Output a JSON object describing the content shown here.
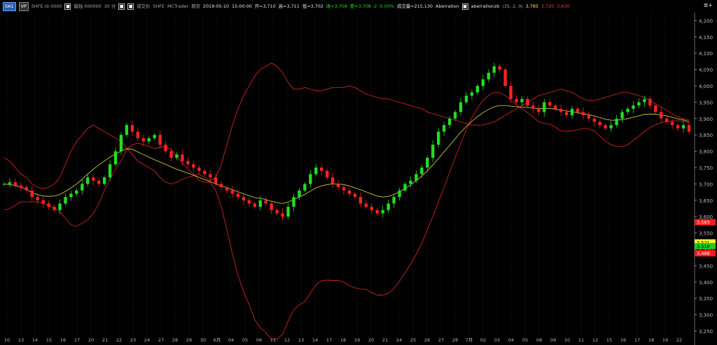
{
  "header": {
    "chart_tag": "SA1",
    "mode_tag": "VP",
    "symbol": "SHFE.rb 0000",
    "symbol_box": "■",
    "chart_type": "蜡烛 000000",
    "interval": "30 分",
    "interval_box": "■",
    "price_type": "成交价",
    "price_box": "■",
    "exchange": "SHFE",
    "provider": "MCTrader",
    "session": "期货",
    "datetime": "2019-05-10",
    "time": "15:00:00",
    "open": "开=3,710",
    "high": "高=3,711",
    "low": "低=3,702",
    "close": "收=3,708",
    "change": "差=3,708 -2 -0.05%",
    "volume": "成交量=215,130",
    "study1_name": "Aberration",
    "study1_box": "■",
    "study2_name": "aberrationzb",
    "study2_params": "(35, 2, 0)",
    "study2_v1": "3,765",
    "study2_v2": "3,720",
    "study2_v3": "3,630",
    "menu_icon": "≣+"
  },
  "colors": {
    "background": "#000000",
    "grid": "#3a3a3a",
    "up": "#22dd22",
    "down": "#ff2222",
    "band": "#cc2222",
    "ma": "#dddd44",
    "signal": "#ffffff",
    "tag_red": "#ff1a1a",
    "tag_green": "#22cc22",
    "tag_yellow": "#ffff22"
  },
  "chart_data": {
    "type": "candlestick",
    "y_ticks": [
      "4,200",
      "4,150",
      "4,100",
      "4,050",
      "4,000",
      "3,950",
      "3,900",
      "3,850",
      "3,800",
      "3,750",
      "3,700",
      "3,650",
      "3,600",
      "3,550",
      "3,500",
      "3,450",
      "3,400",
      "3,350",
      "3,300",
      "3,250"
    ],
    "y_tick_values": [
      4200,
      4150,
      4100,
      4050,
      4000,
      3950,
      3900,
      3850,
      3800,
      3750,
      3700,
      3650,
      3600,
      3550,
      3500,
      3450,
      3400,
      3350,
      3300,
      3250
    ],
    "ylim": [
      3250,
      4220
    ],
    "x_ticks": [
      "10",
      "13",
      "14",
      "15",
      "16",
      "17",
      "20",
      "21",
      "22",
      "23",
      "24",
      "27",
      "28",
      "29",
      "30",
      "6月",
      "04",
      "05",
      "06",
      "11",
      "12",
      "13",
      "14",
      "17",
      "18",
      "19",
      "20",
      "21",
      "24",
      "25",
      "26",
      "27",
      "28",
      "7月",
      "02",
      "03",
      "04",
      "05",
      "08",
      "09",
      "10",
      "11",
      "12",
      "15",
      "16",
      "17",
      "18",
      "19",
      "22"
    ],
    "price_tags": [
      {
        "label": "3,583",
        "value": 3583,
        "color": "tag_red"
      },
      {
        "label": "3,521",
        "value": 3521,
        "color": "tag_yellow"
      },
      {
        "label": "3,510",
        "value": 3510,
        "color": "tag_green"
      },
      {
        "label": "3,488",
        "value": 3488,
        "color": "tag_red"
      }
    ],
    "close_series": [
      3700,
      3705,
      3695,
      3690,
      3680,
      3660,
      3650,
      3640,
      3630,
      3620,
      3640,
      3660,
      3670,
      3680,
      3700,
      3720,
      3710,
      3700,
      3720,
      3760,
      3800,
      3850,
      3880,
      3860,
      3840,
      3830,
      3840,
      3850,
      3820,
      3800,
      3780,
      3790,
      3770,
      3760,
      3750,
      3740,
      3730,
      3720,
      3700,
      3690,
      3680,
      3670,
      3660,
      3650,
      3640,
      3630,
      3650,
      3640,
      3620,
      3610,
      3600,
      3630,
      3660,
      3680,
      3700,
      3730,
      3750,
      3740,
      3720,
      3700,
      3690,
      3680,
      3670,
      3660,
      3640,
      3630,
      3620,
      3610,
      3620,
      3640,
      3660,
      3680,
      3700,
      3710,
      3730,
      3750,
      3780,
      3820,
      3860,
      3880,
      3900,
      3920,
      3950,
      3970,
      3980,
      4000,
      4020,
      4040,
      4060,
      4050,
      4000,
      3960,
      3950,
      3960,
      3940,
      3930,
      3920,
      3950,
      3940,
      3930,
      3920,
      3910,
      3930,
      3920,
      3910,
      3900,
      3890,
      3880,
      3870,
      3880,
      3900,
      3920,
      3930,
      3940,
      3950,
      3960,
      3940,
      3920,
      3900,
      3890,
      3880,
      3870,
      3880,
      3860
    ],
    "upper_band": [
      3780,
      3770,
      3750,
      3730,
      3720,
      3700,
      3690,
      3685,
      3690,
      3700,
      3720,
      3760,
      3800,
      3830,
      3850,
      3870,
      3880,
      3870,
      3860,
      3850,
      3840,
      3830,
      3810,
      3790,
      3770,
      3760,
      3750,
      3740,
      3720,
      3705,
      3700,
      3705,
      3715,
      3720,
      3725,
      3730,
      3720,
      3710,
      3720,
      3760,
      3820,
      3880,
      3930,
      3970,
      4000,
      4030,
      4050,
      4060,
      4070,
      4060,
      4040,
      4010,
      3990,
      3990,
      3995,
      3990,
      3985,
      3985,
      3990,
      3995,
      3995,
      3995,
      4000,
      3995,
      3985,
      3975,
      3970,
      3965,
      3960,
      3960,
      3955,
      3950,
      3945,
      3940,
      3935,
      3930,
      3920,
      3915,
      3910,
      3905,
      3900,
      3895,
      3890,
      3885,
      3880,
      3880,
      3880,
      3885,
      3890,
      3900,
      3910,
      3920,
      3930,
      3940,
      3950,
      3960,
      3970,
      3975,
      3980,
      3985,
      3990,
      3985,
      3980,
      3970,
      3960,
      3955,
      3955,
      3960,
      3965,
      3970,
      3975,
      3980,
      3980,
      3975,
      3970,
      3965,
      3955,
      3945,
      3935,
      3925,
      3915,
      3905,
      3900,
      3895
    ],
    "middle_band": [
      3700,
      3698,
      3695,
      3690,
      3683,
      3673,
      3667,
      3663,
      3662,
      3663,
      3668,
      3677,
      3688,
      3700,
      3715,
      3730,
      3745,
      3758,
      3770,
      3782,
      3792,
      3800,
      3808,
      3806,
      3798,
      3790,
      3782,
      3774,
      3767,
      3760,
      3752,
      3745,
      3739,
      3733,
      3727,
      3720,
      3713,
      3707,
      3700,
      3694,
      3688,
      3682,
      3676,
      3670,
      3664,
      3658,
      3656,
      3652,
      3647,
      3643,
      3640,
      3645,
      3652,
      3660,
      3668,
      3678,
      3688,
      3694,
      3698,
      3700,
      3700,
      3698,
      3694,
      3688,
      3682,
      3676,
      3669,
      3663,
      3660,
      3662,
      3668,
      3676,
      3686,
      3697,
      3710,
      3724,
      3740,
      3758,
      3778,
      3798,
      3818,
      3838,
      3858,
      3876,
      3892,
      3906,
      3918,
      3928,
      3936,
      3940,
      3940,
      3938,
      3936,
      3935,
      3934,
      3932,
      3930,
      3931,
      3931,
      3929,
      3926,
      3923,
      3921,
      3918,
      3915,
      3912,
      3908,
      3903,
      3898,
      3895,
      3895,
      3897,
      3900,
      3904,
      3908,
      3913,
      3914,
      3913,
      3911,
      3908,
      3904,
      3899,
      3896,
      3891
    ],
    "lower_band": [
      3620,
      3625,
      3635,
      3645,
      3645,
      3645,
      3645,
      3640,
      3635,
      3625,
      3615,
      3595,
      3575,
      3570,
      3580,
      3590,
      3610,
      3640,
      3680,
      3715,
      3745,
      3770,
      3805,
      3820,
      3825,
      3820,
      3815,
      3808,
      3812,
      3815,
      3805,
      3785,
      3765,
      3745,
      3730,
      3710,
      3705,
      3705,
      3680,
      3630,
      3560,
      3485,
      3420,
      3370,
      3330,
      3285,
      3260,
      3245,
      3225,
      3225,
      3240,
      3280,
      3315,
      3330,
      3340,
      3366,
      3392,
      3404,
      3406,
      3405,
      3405,
      3400,
      3388,
      3382,
      3378,
      3378,
      3368,
      3360,
      3360,
      3365,
      3380,
      3402,
      3428,
      3455,
      3485,
      3518,
      3560,
      3600,
      3646,
      3690,
      3735,
      3780,
      3825,
      3866,
      3903,
      3932,
      3956,
      3970,
      3980,
      3980,
      3970,
      3957,
      3942,
      3930,
      3918,
      3905,
      3890,
      3885,
      3883,
      3874,
      3862,
      3861,
      3862,
      3866,
      3870,
      3869,
      3862,
      3846,
      3831,
      3820,
      3815,
      3814,
      3820,
      3833,
      3846,
      3861,
      3873,
      3881,
      3887,
      3891,
      3893,
      3893,
      3892,
      3887
    ]
  }
}
